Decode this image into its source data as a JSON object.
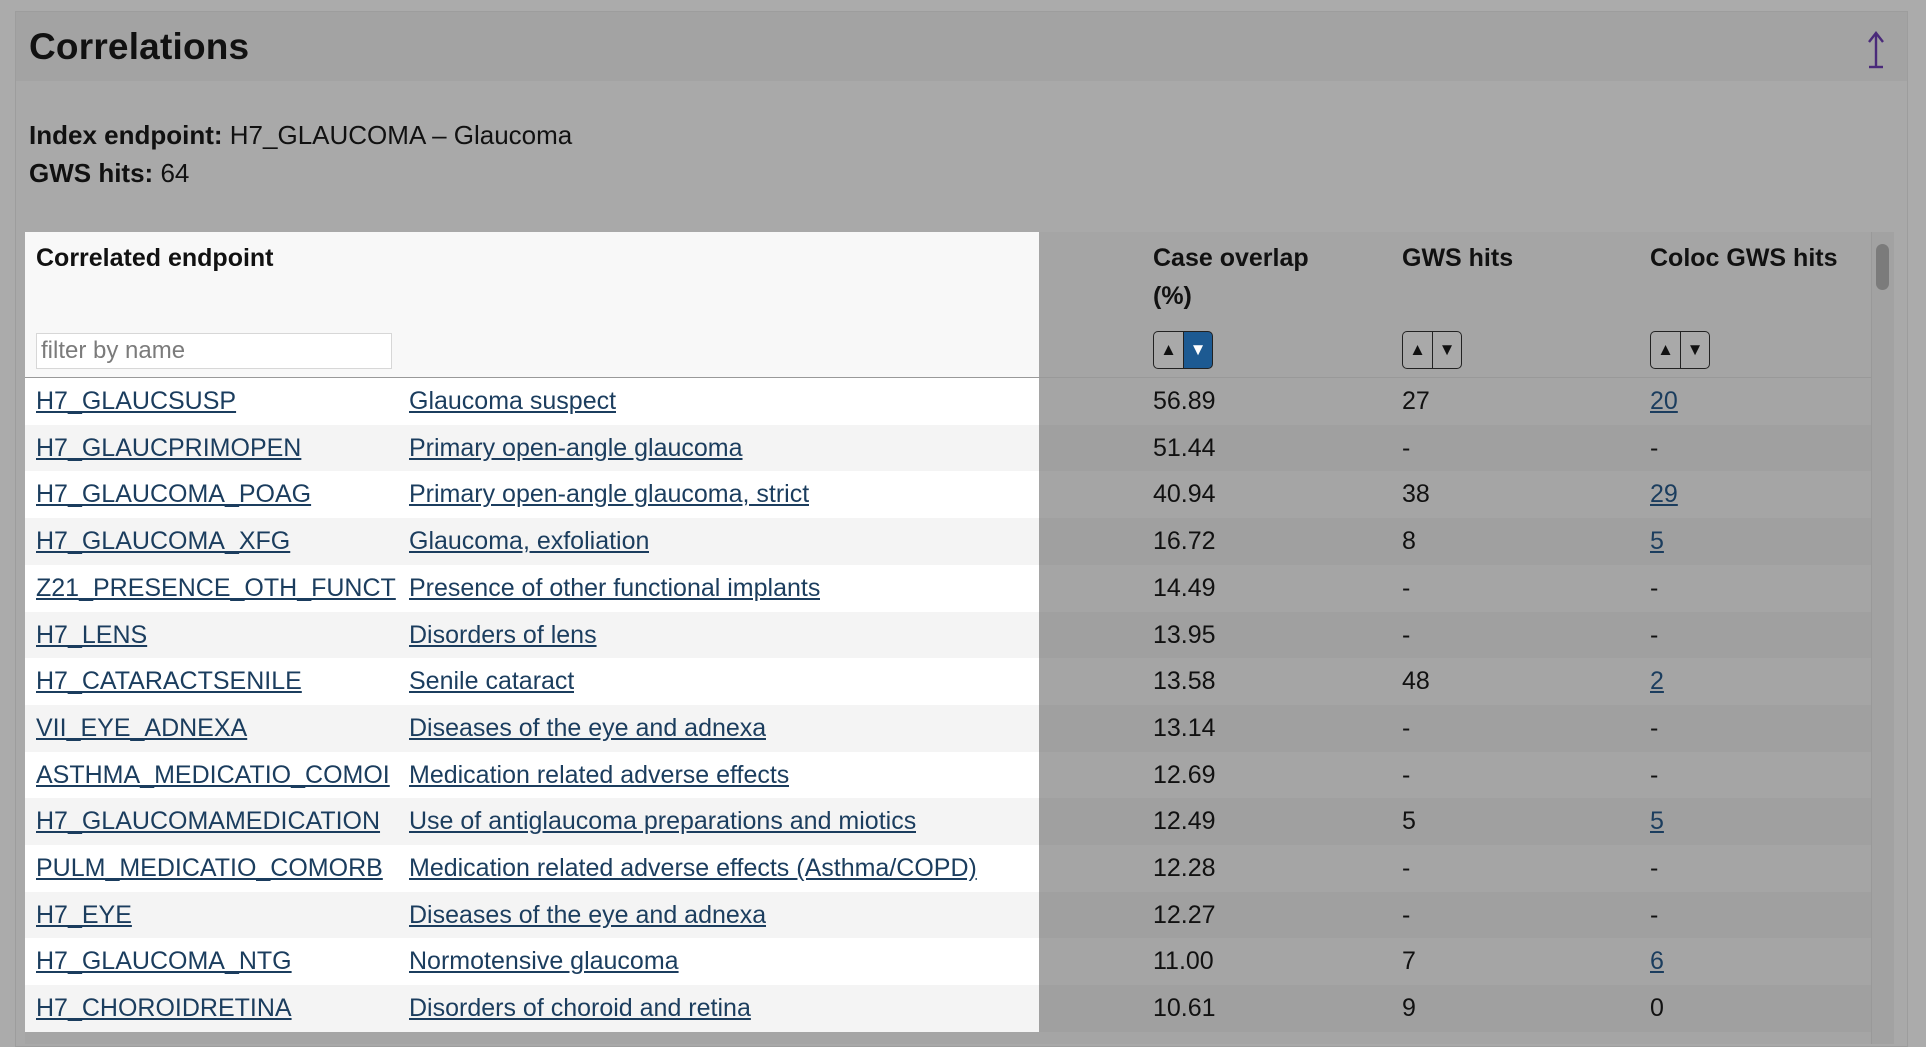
{
  "panel": {
    "title": "Correlations",
    "up_icon": "up-arrow-icon"
  },
  "meta": {
    "index_label": "Index endpoint:",
    "index_value": "H7_GLAUCOMA – Glaucoma",
    "gws_label": "GWS hits:",
    "gws_value": "64"
  },
  "table": {
    "headers": {
      "correlated": "Correlated endpoint",
      "overlap": "Case overlap (%)",
      "gws": "GWS hits",
      "coloc": "Coloc GWS hits"
    },
    "filter_placeholder": "filter by name",
    "sort": {
      "up_glyph": "▲",
      "down_glyph": "▼",
      "active_column": "overlap",
      "active_direction": "desc"
    },
    "rows": [
      {
        "code": "H7_GLAUCSUSP",
        "name": "Glaucoma suspect",
        "overlap": "56.89",
        "gws": "27",
        "coloc": "20",
        "coloc_link": true
      },
      {
        "code": "H7_GLAUCPRIMOPEN",
        "name": "Primary open-angle glaucoma",
        "overlap": "51.44",
        "gws": "-",
        "coloc": "-",
        "coloc_link": false
      },
      {
        "code": "H7_GLAUCOMA_POAG",
        "name": "Primary open-angle glaucoma, strict",
        "overlap": "40.94",
        "gws": "38",
        "coloc": "29",
        "coloc_link": true
      },
      {
        "code": "H7_GLAUCOMA_XFG",
        "name": "Glaucoma, exfoliation",
        "overlap": "16.72",
        "gws": "8",
        "coloc": "5",
        "coloc_link": true
      },
      {
        "code": "Z21_PRESENCE_OTH_FUNCT",
        "name": "Presence of other functional implants",
        "overlap": "14.49",
        "gws": "-",
        "coloc": "-",
        "coloc_link": false
      },
      {
        "code": "H7_LENS",
        "name": "Disorders of lens",
        "overlap": "13.95",
        "gws": "-",
        "coloc": "-",
        "coloc_link": false
      },
      {
        "code": "H7_CATARACTSENILE",
        "name": "Senile cataract",
        "overlap": "13.58",
        "gws": "48",
        "coloc": "2",
        "coloc_link": true
      },
      {
        "code": "VII_EYE_ADNEXA",
        "name": "Diseases of the eye and adnexa",
        "overlap": "13.14",
        "gws": "-",
        "coloc": "-",
        "coloc_link": false
      },
      {
        "code": "ASTHMA_MEDICATIO_COMOI",
        "name": "Medication related adverse effects",
        "overlap": "12.69",
        "gws": "-",
        "coloc": "-",
        "coloc_link": false
      },
      {
        "code": "H7_GLAUCOMAMEDICATION",
        "name": "Use of antiglaucoma preparations and miotics",
        "overlap": "12.49",
        "gws": "5",
        "coloc": "5",
        "coloc_link": true
      },
      {
        "code": "PULM_MEDICATIO_COMORB",
        "name": "Medication related adverse effects (Asthma/COPD)",
        "overlap": "12.28",
        "gws": "-",
        "coloc": "-",
        "coloc_link": false
      },
      {
        "code": "H7_EYE",
        "name": "Diseases of the eye and adnexa",
        "overlap": "12.27",
        "gws": "-",
        "coloc": "-",
        "coloc_link": false
      },
      {
        "code": "H7_GLAUCOMA_NTG",
        "name": "Normotensive glaucoma",
        "overlap": "11.00",
        "gws": "7",
        "coloc": "6",
        "coloc_link": true
      },
      {
        "code": "H7_CHOROIDRETINA",
        "name": "Disorders of choroid and retina",
        "overlap": "10.61",
        "gws": "9",
        "coloc": "0",
        "coloc_link": false
      }
    ]
  }
}
